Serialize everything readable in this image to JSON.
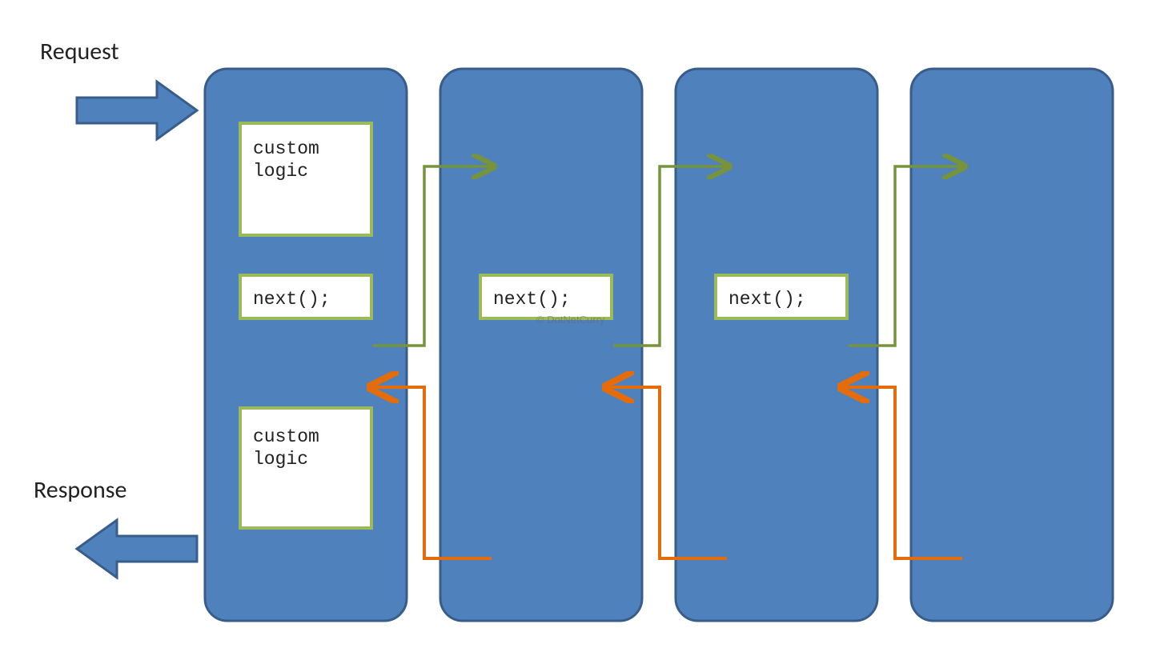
{
  "labels": {
    "request": "Request",
    "response": "Response",
    "watermark": "© DotNetCurry"
  },
  "boxes": {
    "custom_logic_top": "custom\nlogic",
    "custom_logic_bottom": "custom\nlogic",
    "next1": "next();",
    "next2": "next();",
    "next3": "next();"
  },
  "colors": {
    "middleware_fill": "#4F81BD",
    "middleware_stroke": "#385D8A",
    "box_border": "#9BBB59",
    "forward_arrow": "#77933C",
    "back_arrow": "#E46C0A",
    "big_arrow_fill": "#4F81BD",
    "big_arrow_stroke": "#385D8A"
  }
}
